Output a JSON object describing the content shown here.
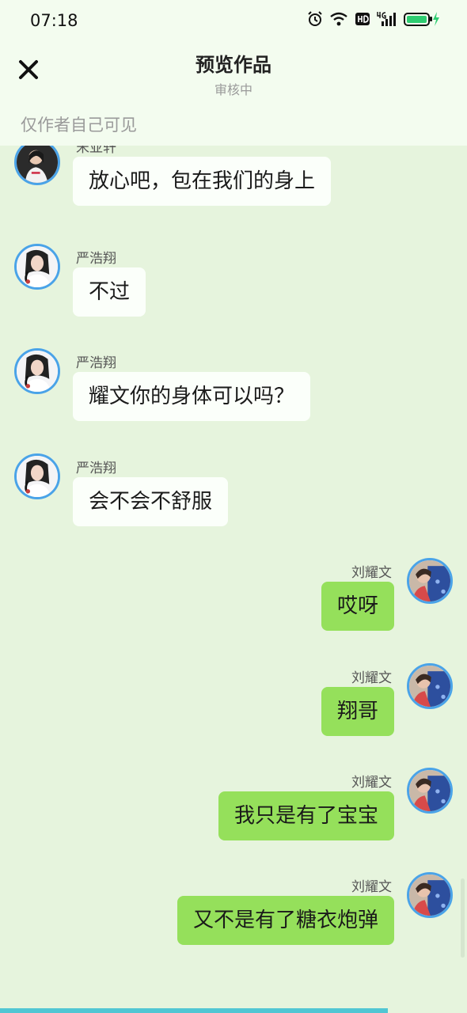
{
  "status_bar": {
    "time": "07:18",
    "icons": [
      "alarm-icon",
      "wifi-icon",
      "hd-icon",
      "4g-signal-icon",
      "battery-charging-icon"
    ]
  },
  "header": {
    "close_icon": "close-icon",
    "title": "预览作品",
    "subtitle": "审核中",
    "visibility": "仅作者自己可见"
  },
  "messages": [
    {
      "side": "left",
      "name": "宋亚轩",
      "text": "放心吧，包在我们的身上"
    },
    {
      "side": "left",
      "name": "严浩翔",
      "text": "不过"
    },
    {
      "side": "left",
      "name": "严浩翔",
      "text": "耀文你的身体可以吗？"
    },
    {
      "side": "left",
      "name": "严浩翔",
      "text": "会不会不舒服"
    },
    {
      "side": "right",
      "name": "刘耀文",
      "text": "哎呀"
    },
    {
      "side": "right",
      "name": "刘耀文",
      "text": "翔哥"
    },
    {
      "side": "right",
      "name": "刘耀文",
      "text": "我只是有了宝宝"
    },
    {
      "side": "right",
      "name": "刘耀文",
      "text": "又不是有了糖衣炮弹"
    }
  ],
  "progress": 0.83,
  "colors": {
    "background": "#e6f4dd",
    "header_bg": "#f3fcef",
    "own_bubble": "#95e05b",
    "other_bubble": "#fbfffa",
    "avatar_ring": "#4aa3e8",
    "progress": "#51c6d3",
    "battery": "#2ecc71"
  }
}
